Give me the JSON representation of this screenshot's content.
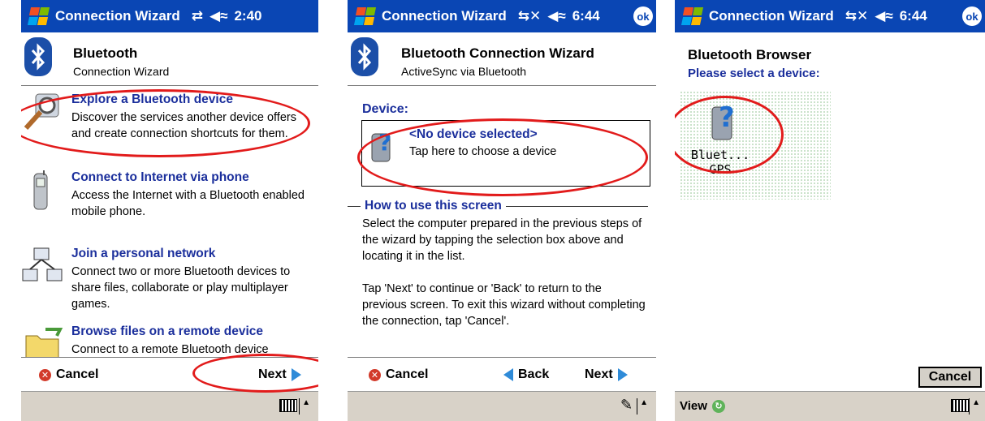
{
  "panel1": {
    "titlebar": {
      "title": "Connection Wizard",
      "time": "2:40"
    },
    "header": {
      "title": "Bluetooth",
      "subtitle": "Connection Wizard"
    },
    "items": [
      {
        "title": "Explore a Bluetooth device",
        "desc": "Discover the services another device offers and create connection shortcuts for them."
      },
      {
        "title": "Connect to Internet via phone",
        "desc": "Access the Internet with a Bluetooth enabled mobile phone."
      },
      {
        "title": "Join a personal network",
        "desc": "Connect two or more Bluetooth devices to share files, collaborate or play multiplayer games."
      },
      {
        "title": "Browse files on a remote device",
        "desc": "Connect to a remote Bluetooth device"
      }
    ],
    "cancel_label": "Cancel",
    "next_label": "Next"
  },
  "panel2": {
    "titlebar": {
      "title": "Connection Wizard",
      "time": "6:44",
      "ok": "ok"
    },
    "header": {
      "title": "Bluetooth Connection Wizard",
      "subtitle": "ActiveSync via Bluetooth"
    },
    "device_label": "Device:",
    "device_title": "<No device selected>",
    "device_sub": "Tap here to choose a device",
    "how_label": "How to use this screen",
    "para1": "Select the computer prepared in the previous steps of the wizard by tapping the selection box above and locating it in the list.",
    "para2": "Tap 'Next' to continue or 'Back' to return to the previous screen. To exit this wizard without completing the connection, tap 'Cancel'.",
    "cancel_label": "Cancel",
    "back_label": "Back",
    "next_label": "Next"
  },
  "panel3": {
    "titlebar": {
      "title": "Connection Wizard",
      "time": "6:44",
      "ok": "ok"
    },
    "title": "Bluetooth Browser",
    "subtitle": "Please select a device:",
    "device_line1": "Bluet...",
    "device_line2": "GPS",
    "cancel_label": "Cancel",
    "view_label": "View"
  },
  "colors": {
    "titlebar": "#0a46b4",
    "link_blue": "#1b2f9c",
    "annotation_red": "#e21b1b",
    "menubar": "#d8d2c8"
  }
}
